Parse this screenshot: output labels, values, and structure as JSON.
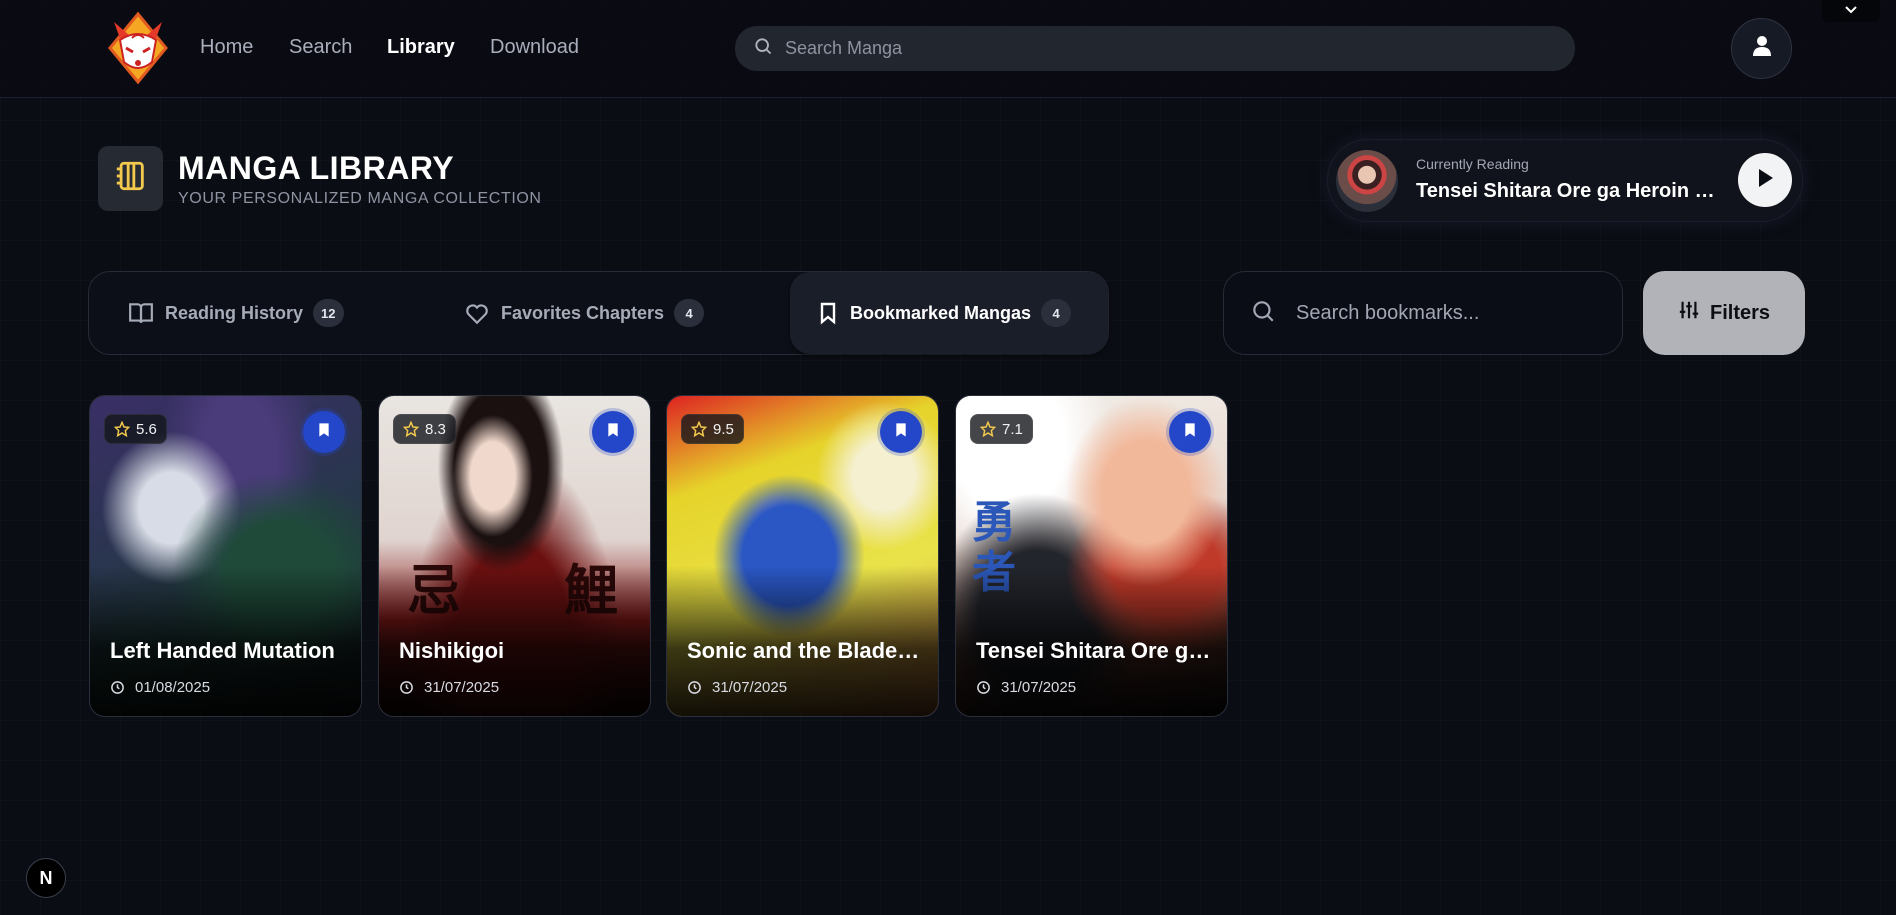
{
  "nav": {
    "links": [
      "Home",
      "Search",
      "Library",
      "Download"
    ],
    "active": "Library",
    "search_placeholder": "Search Manga",
    "logo_icon": "kitsune-mask-logo",
    "user_icon": "user-icon"
  },
  "header": {
    "title": "MANGA LIBRARY",
    "subtitle": "YOUR PERSONALIZED MANGA COLLECTION",
    "icon": "notebook-icon"
  },
  "currently_reading": {
    "label": "Currently Reading",
    "title": "Tensei Shitara Ore ga Heroin to Shite Yuusha datta Ken"
  },
  "tabs": [
    {
      "label": "Reading History",
      "count": "12",
      "icon": "book-open-icon"
    },
    {
      "label": "Favorites Chapters",
      "count": "4",
      "icon": "heart-icon"
    },
    {
      "label": "Bookmarked Mangas",
      "count": "4",
      "icon": "bookmark-icon",
      "active": true
    }
  ],
  "bookmark_search": {
    "placeholder": "Search bookmarks..."
  },
  "filters": {
    "label": "Filters"
  },
  "cards": [
    {
      "title": "Left Handed Mutation",
      "rating": "5.6",
      "date": "01/08/2025"
    },
    {
      "title": "Nishikigoi",
      "rating": "8.3",
      "date": "31/07/2025"
    },
    {
      "title": "Sonic and the Blade of the Hero",
      "rating": "9.5",
      "date": "31/07/2025"
    },
    {
      "title": "Tensei Shitara Ore ga Heroin de Yuusha datta",
      "rating": "7.1",
      "date": "31/07/2025"
    }
  ],
  "colors": {
    "accent_blue": "#2447c9",
    "background": "#0b0d14",
    "star": "#f2c94c"
  },
  "dev_badge": "N"
}
